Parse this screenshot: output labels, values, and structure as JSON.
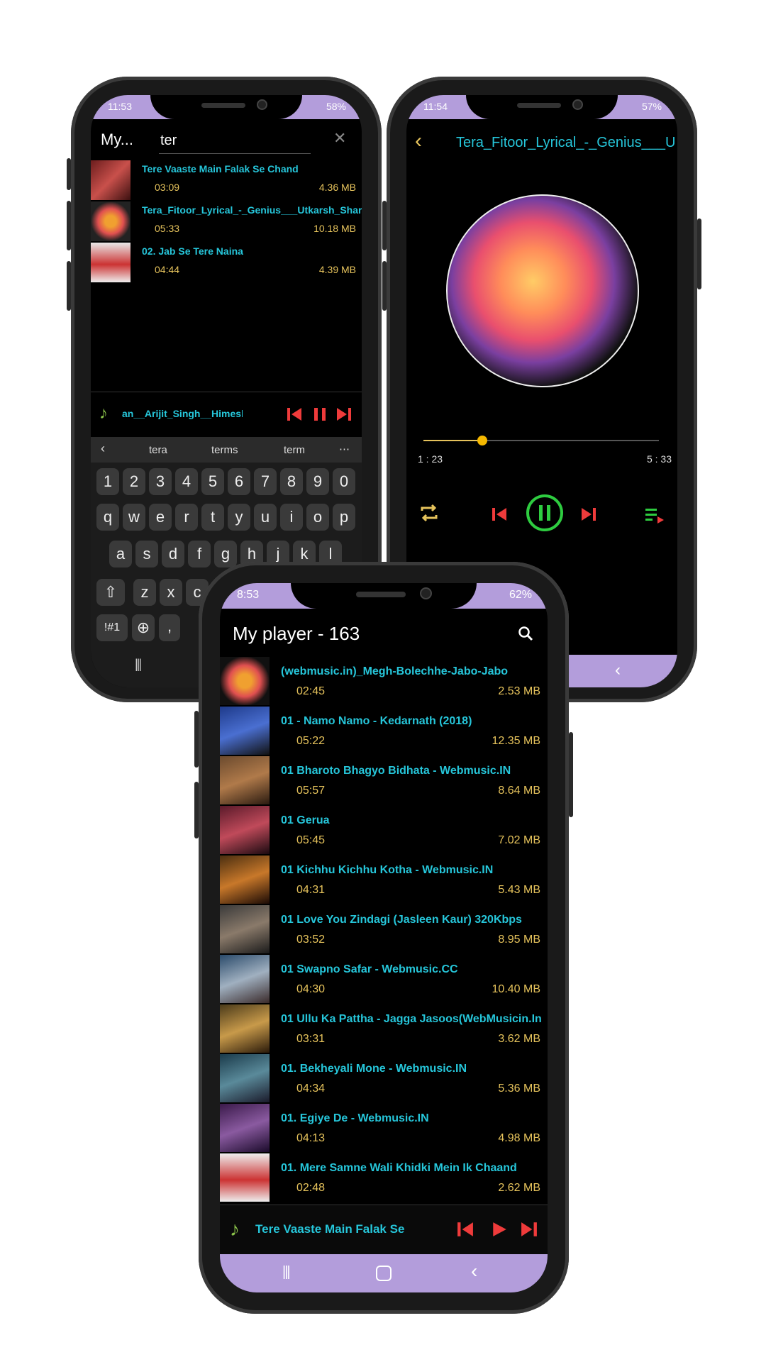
{
  "phone_left": {
    "status": {
      "time": "11:53",
      "battery": "58%"
    },
    "app_title_short": "My...",
    "search": {
      "value": "ter",
      "placeholder": ""
    },
    "results": [
      {
        "title": "Tere Vaaste Main Falak Se Chand",
        "duration": "03:09",
        "size": "4.36 MB"
      },
      {
        "title": "Tera_Fitoor_Lyrical_-_Genius___Utkarsh_Sharma",
        "duration": "05:33",
        "size": "10.18 MB"
      },
      {
        "title": "02. Jab Se Tere Naina",
        "duration": "04:44",
        "size": "4.39 MB"
      }
    ],
    "mini_player": {
      "title": "an__Arijit_Singh__Himesh_Resha"
    },
    "keyboard": {
      "suggestions": [
        "tera",
        "terms",
        "term"
      ],
      "more": "⋯",
      "numbers": [
        "1",
        "2",
        "3",
        "4",
        "5",
        "6",
        "7",
        "8",
        "9",
        "0"
      ],
      "row1": [
        "q",
        "w",
        "e",
        "r",
        "t",
        "y",
        "u",
        "i",
        "o",
        "p"
      ],
      "row2": [
        "a",
        "s",
        "d",
        "f",
        "g",
        "h",
        "j",
        "k",
        "l"
      ],
      "row3": [
        "z",
        "x",
        "c"
      ],
      "symbols": "!#1",
      "comma": ","
    }
  },
  "phone_right": {
    "status": {
      "time": "11:54",
      "battery": "57%"
    },
    "title": "Tera_Fitoor_Lyrical_-_Genius___U",
    "progress": {
      "current": "1 : 23",
      "total": "5 : 33",
      "fraction": 0.25
    }
  },
  "phone_front": {
    "status": {
      "time": "8:53",
      "battery": "62%"
    },
    "app_title": "My player - 163",
    "songs": [
      {
        "title": "(webmusic.in)_Megh-Bolechhe-Jabo-Jabo",
        "duration": "02:45",
        "size": "2.53 MB"
      },
      {
        "title": "01 - Namo Namo - Kedarnath (2018)",
        "duration": "05:22",
        "size": "12.35 MB"
      },
      {
        "title": "01 Bharoto Bhagyo Bidhata - Webmusic.IN",
        "duration": "05:57",
        "size": "8.64 MB"
      },
      {
        "title": "01 Gerua",
        "duration": "05:45",
        "size": "7.02 MB"
      },
      {
        "title": "01 Kichhu Kichhu Kotha - Webmusic.IN",
        "duration": "04:31",
        "size": "5.43 MB"
      },
      {
        "title": "01 Love You Zindagi (Jasleen Kaur) 320Kbps",
        "duration": "03:52",
        "size": "8.95 MB"
      },
      {
        "title": "01 Swapno Safar - Webmusic.CC",
        "duration": "04:30",
        "size": "10.40 MB"
      },
      {
        "title": "01 Ullu Ka Pattha - Jagga Jasoos(WebMusicin.In",
        "duration": "03:31",
        "size": "3.62 MB"
      },
      {
        "title": "01. Bekheyali Mone - Webmusic.IN",
        "duration": "04:34",
        "size": "5.36 MB"
      },
      {
        "title": "01. Egiye De - Webmusic.IN",
        "duration": "04:13",
        "size": "4.98 MB"
      },
      {
        "title": "01. Mere Samne Wali Khidki Mein Ik Chaand",
        "duration": "02:48",
        "size": "2.62 MB"
      }
    ],
    "mini_player": {
      "title": "Tere Vaaste Main Falak Se Chand La"
    }
  },
  "colors": {
    "accent_teal": "#26c6da",
    "gold": "#e6c35c",
    "red_control": "#ef3b3b",
    "green_play": "#2ecc40",
    "lavender": "#b39ddb"
  },
  "icons": {
    "back": "back-icon",
    "search": "search-icon",
    "close": "close-icon",
    "music_note": "music-note-icon",
    "previous": "previous-icon",
    "pause": "pause-icon",
    "play": "play-icon",
    "next": "next-icon",
    "repeat": "repeat-icon",
    "queue": "queue-icon"
  }
}
